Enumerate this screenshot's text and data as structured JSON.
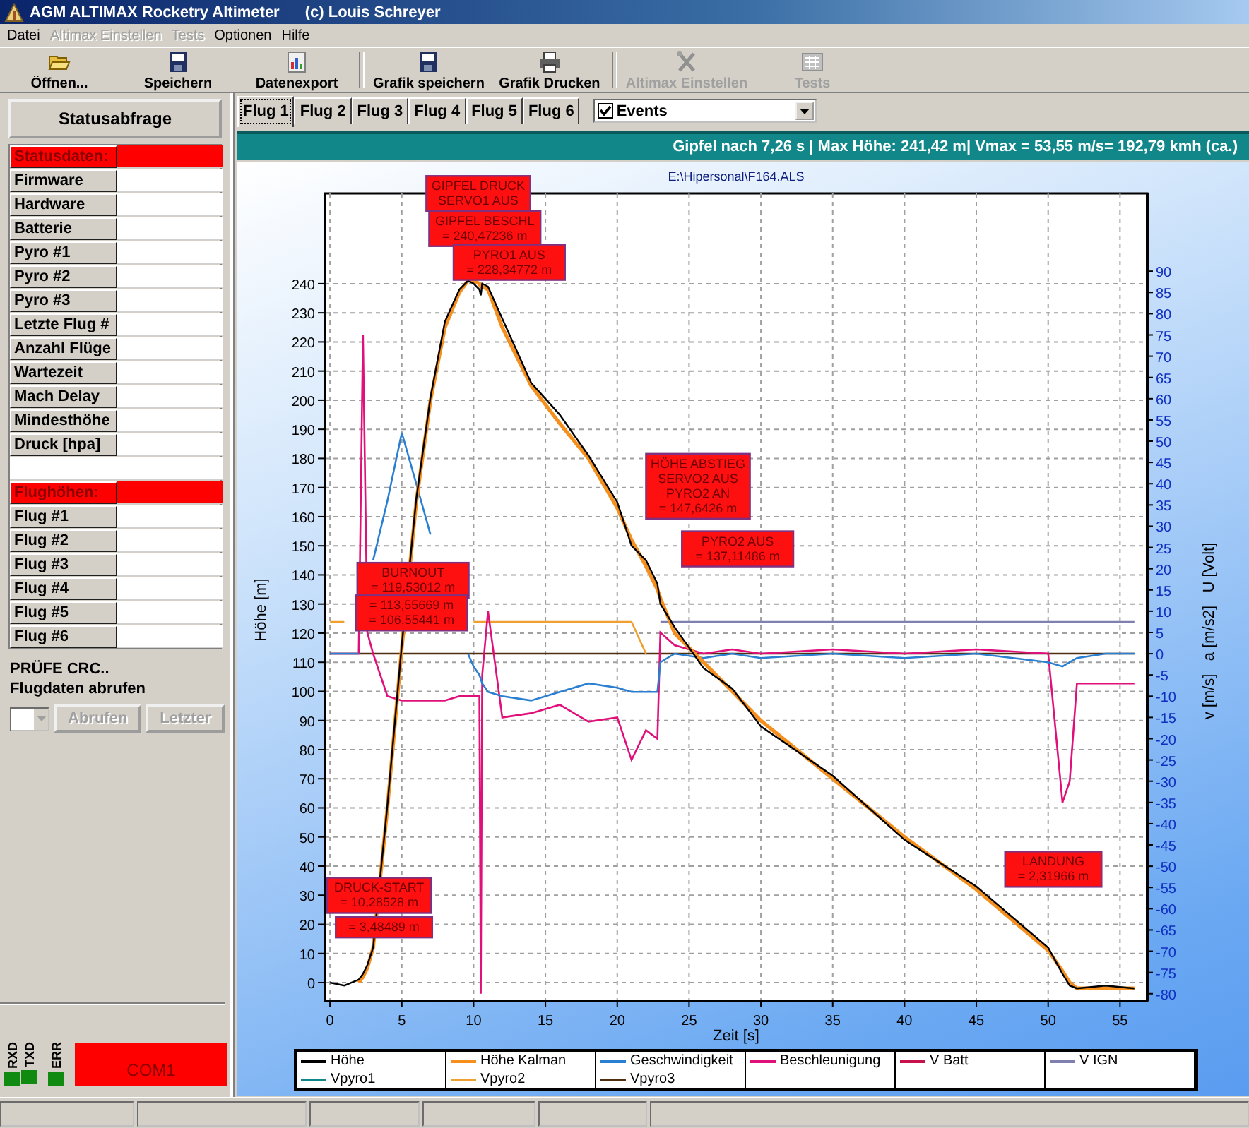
{
  "window": {
    "title": "AGM ALTIMAX Rocketry Altimeter",
    "copyright": "(c) Louis Schreyer"
  },
  "menu": [
    {
      "label": "Datei",
      "disabled": false
    },
    {
      "label": "Altimax Einstellen",
      "disabled": true
    },
    {
      "label": "Tests",
      "disabled": true
    },
    {
      "label": "Optionen",
      "disabled": false
    },
    {
      "label": "Hilfe",
      "disabled": false
    }
  ],
  "toolbar": [
    {
      "label": "Öffnen...",
      "kind": "open",
      "disabled": false,
      "separator_before": false
    },
    {
      "label": "Speichern",
      "kind": "save",
      "disabled": false,
      "separator_before": false
    },
    {
      "label": "Datenexport",
      "kind": "export",
      "disabled": false,
      "separator_before": false
    },
    {
      "label": "Grafik speichern",
      "kind": "save",
      "disabled": false,
      "separator_before": true
    },
    {
      "label": "Grafik Drucken",
      "kind": "print",
      "disabled": false,
      "separator_before": false
    },
    {
      "label": "Altimax Einstellen",
      "kind": "tools",
      "disabled": true,
      "separator_before": true
    },
    {
      "label": "Tests",
      "kind": "tests",
      "disabled": true,
      "separator_before": false
    }
  ],
  "status_button": "Statusabfrage",
  "status_table": [
    {
      "kind": "header",
      "label": "Statusdaten:"
    },
    {
      "kind": "row",
      "label": "Firmware"
    },
    {
      "kind": "row",
      "label": "Hardware"
    },
    {
      "kind": "row",
      "label": "Batterie"
    },
    {
      "kind": "row",
      "label": "Pyro #1"
    },
    {
      "kind": "row",
      "label": "Pyro #2"
    },
    {
      "kind": "row",
      "label": "Pyro #3"
    },
    {
      "kind": "row",
      "label": "Letzte Flug #"
    },
    {
      "kind": "row",
      "label": "Anzahl Flüge"
    },
    {
      "kind": "row",
      "label": "Wartezeit"
    },
    {
      "kind": "row",
      "label": "Mach Delay"
    },
    {
      "kind": "row",
      "label": "Mindesthöhe"
    },
    {
      "kind": "row",
      "label": "Druck [hpa]"
    },
    {
      "kind": "blank"
    },
    {
      "kind": "header",
      "label": "Flughöhen:"
    },
    {
      "kind": "row",
      "label": "Flug #1"
    },
    {
      "kind": "row",
      "label": "Flug #2"
    },
    {
      "kind": "row",
      "label": "Flug #3"
    },
    {
      "kind": "row",
      "label": "Flug #4"
    },
    {
      "kind": "row",
      "label": "Flug #5"
    },
    {
      "kind": "row",
      "label": "Flug #6"
    }
  ],
  "crc_text": "PRÜFE CRC..",
  "fetch_label": "Flugdaten abrufen",
  "fetch_buttons": [
    {
      "label": "Abrufen",
      "disabled": true
    },
    {
      "label": "Letzter",
      "disabled": true
    }
  ],
  "leds": [
    {
      "label": "RXD",
      "on": true
    },
    {
      "label": "TXD",
      "on": true
    },
    {
      "label": "ERR",
      "on": true
    }
  ],
  "port": {
    "label": "COM1",
    "connected": false
  },
  "flight_tabs": [
    {
      "label": "Flug 1",
      "selected": true
    },
    {
      "label": "Flug 2",
      "selected": false
    },
    {
      "label": "Flug 3",
      "selected": false
    },
    {
      "label": "Flug 4",
      "selected": false
    },
    {
      "label": "Flug 5",
      "selected": false
    },
    {
      "label": "Flug 6",
      "selected": false
    }
  ],
  "events_combo": {
    "label": "Events",
    "checked": true
  },
  "summary": "Gipfel nach 7,26 s | Max Höhe: 241,42 m| Vmax = 53,55 m/s= 192,79 kmh (ca.)",
  "chart_data": {
    "type": "line",
    "title": "E:\\Hipersonal\\F164.ALS",
    "xlabel": "Zeit [s]",
    "ylabel": "Höhe [m]",
    "y2label": "v [m/s]   a [m/s2]   U [Volt]",
    "grid": true,
    "legend": true,
    "xlim": [
      -0.35,
      56.9
    ],
    "ylim": [
      -6.3,
      271
    ],
    "y2lim": [
      -81.7,
      108.3
    ],
    "xticks": [
      0,
      5,
      10,
      15,
      20,
      25,
      30,
      35,
      40,
      45,
      50,
      55
    ],
    "yticks": [
      0,
      10,
      20,
      30,
      40,
      50,
      60,
      70,
      80,
      90,
      100,
      110,
      120,
      130,
      140,
      150,
      160,
      170,
      180,
      190,
      200,
      210,
      220,
      230,
      240
    ],
    "y2ticks": [
      -80,
      -75,
      -70,
      -65,
      -60,
      -55,
      -50,
      -45,
      -40,
      -35,
      -30,
      -25,
      -20,
      -15,
      -10,
      -5,
      0,
      5,
      10,
      15,
      20,
      25,
      30,
      35,
      40,
      45,
      50,
      55,
      60,
      65,
      70,
      75,
      80,
      85,
      90
    ],
    "x": [
      0,
      1,
      2,
      2.3,
      2.6,
      3,
      4,
      5,
      6,
      7,
      8,
      9,
      9.6,
      10,
      10.4,
      10.5,
      10.6,
      11,
      12,
      14,
      16,
      18,
      20,
      21,
      22,
      22.8,
      23,
      24,
      26,
      28,
      30,
      35,
      40,
      45,
      50,
      51,
      51.5,
      52,
      54,
      56
    ],
    "series": [
      {
        "name": "Höhe",
        "color": "#000000",
        "values": [
          0,
          -1,
          1,
          3,
          6,
          12,
          61,
          116,
          166,
          201,
          227,
          238,
          241,
          240,
          238,
          236,
          240,
          239,
          228,
          206,
          195,
          181,
          165,
          150,
          145,
          137,
          130,
          122,
          108,
          101,
          88,
          71,
          49,
          33,
          12,
          3,
          -1,
          -2,
          -1,
          -2
        ]
      },
      {
        "name": "Höhe Kalman",
        "color": "#f5901e",
        "values": [
          null,
          null,
          0,
          2,
          5,
          12,
          60,
          115,
          165,
          200,
          225,
          237,
          241,
          241,
          240,
          239,
          239,
          238,
          225,
          205,
          192,
          180,
          163,
          152,
          143,
          135,
          132,
          120,
          110,
          100,
          90,
          70,
          50,
          32,
          11,
          4,
          0,
          -2,
          -2,
          -2
        ]
      },
      {
        "name": "Geschwindigkeit",
        "color": "#2a7fd0",
        "axis": "y2",
        "values": [
          0,
          0,
          0,
          null,
          null,
          22,
          36,
          52,
          40,
          28,
          null,
          null,
          0,
          -3,
          -5,
          -6,
          -7,
          -9,
          -10,
          -11,
          -9,
          -7,
          -8,
          -9,
          -9,
          -9,
          -2,
          0,
          -1,
          0,
          -1,
          0,
          -1,
          0,
          -2,
          -3,
          -2,
          -1,
          0,
          0
        ]
      },
      {
        "name": "Beschleunigung",
        "color": "#e0107a",
        "axis": "y2",
        "values": [
          0,
          0,
          0,
          75,
          5,
          0,
          -10,
          -11,
          -11,
          -11,
          -11,
          -10,
          -10,
          -10,
          -10,
          -80,
          -5,
          10,
          -15,
          -14,
          -12,
          -16,
          -15,
          -25,
          -18,
          -20,
          5,
          2,
          0,
          1,
          0,
          1,
          0,
          1,
          0,
          -35,
          -30,
          -7,
          -7,
          -7
        ]
      },
      {
        "name": "V Batt",
        "color": "#c8104a",
        "axis": "y2",
        "values": [
          null,
          null,
          null,
          null,
          null,
          null,
          null,
          null,
          null,
          null,
          null,
          null,
          null,
          null,
          null,
          null,
          null,
          null,
          null,
          null,
          null,
          null,
          null,
          null,
          null,
          null,
          null,
          null,
          null,
          null,
          null,
          null,
          null,
          null,
          null,
          null,
          null,
          null,
          null,
          null
        ]
      },
      {
        "name": "V IGN",
        "color": "#8080b0",
        "axis": "y2",
        "values": [
          null,
          null,
          null,
          null,
          null,
          null,
          null,
          null,
          null,
          null,
          null,
          null,
          null,
          null,
          null,
          null,
          null,
          null,
          null,
          null,
          null,
          null,
          null,
          null,
          null,
          null,
          7.5,
          7.5,
          7.5,
          7.5,
          7.5,
          7.5,
          7.5,
          7.5,
          7.5,
          7.5,
          7.5,
          7.5,
          7.5,
          7.5
        ]
      },
      {
        "name": "Vpyro1",
        "color": "#108888",
        "axis": "y2",
        "values": [
          null,
          null,
          null,
          null,
          null,
          null,
          null,
          null,
          null,
          null,
          null,
          null,
          null,
          null,
          null,
          null,
          null,
          null,
          null,
          null,
          null,
          null,
          null,
          null,
          null,
          null,
          null,
          null,
          null,
          null,
          null,
          null,
          null,
          null,
          null,
          null,
          null,
          null,
          null,
          null
        ]
      },
      {
        "name": "Vpyro2",
        "color": "#f0a030",
        "axis": "y2",
        "values": [
          7.5,
          7.5,
          null,
          null,
          null,
          null,
          null,
          null,
          null,
          null,
          null,
          null,
          null,
          7.5,
          7.5,
          7.5,
          7.5,
          7.5,
          7.5,
          7.5,
          7.5,
          7.5,
          7.5,
          7.5,
          0,
          null,
          null,
          null,
          null,
          null,
          null,
          null,
          null,
          null,
          null,
          null,
          null,
          null,
          null,
          null
        ]
      },
      {
        "name": "Vpyro3",
        "color": "#503010",
        "axis": "y2",
        "values": [
          0,
          0,
          0,
          0,
          0,
          0,
          0,
          0,
          0,
          0,
          0,
          0,
          0,
          0,
          0,
          0,
          0,
          0,
          0,
          0,
          0,
          0,
          0,
          0,
          0,
          0,
          0,
          0,
          0,
          0,
          0,
          0,
          0,
          0,
          0,
          0,
          0,
          0,
          0,
          0
        ]
      }
    ],
    "annotations": [
      "GIPFEL DRUCK\nSERVO1 AUS",
      "GIPFEL BESCHL\n= 240,47236 m",
      "PYRO1 AUS\n= 228,34772 m",
      "HÖHE ABSTIEG\nSERVO2 AUS\nPYRO2 AN\n= 147,6426 m",
      "PYRO2 AUS\n= 137,11486 m",
      "BURNOUT\n= 119,53012 m",
      "= 113,55669 m\n= 106,55441 m",
      "DRUCK-START\n= 10,28528 m",
      "= 3,48489 m",
      "LANDUNG\n= 2,31966 m"
    ]
  }
}
